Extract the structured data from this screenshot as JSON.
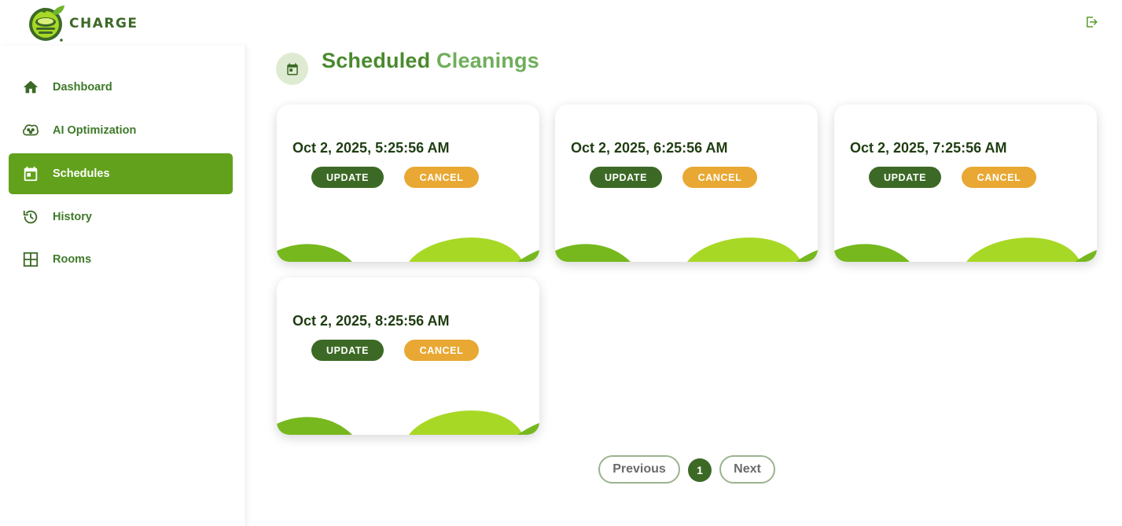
{
  "brand": {
    "name": "CHARGE"
  },
  "colors": {
    "primary_dark": "#3c6a26",
    "active_nav": "#61a11b",
    "cancel": "#e8a833",
    "wave_light": "#a8d826",
    "wave_dark": "#76b81e"
  },
  "sidebar": {
    "items": [
      {
        "label": "Dashboard",
        "icon": "home-icon",
        "active": false
      },
      {
        "label": "AI Optimization",
        "icon": "brain-icon",
        "active": false
      },
      {
        "label": "Schedules",
        "icon": "calendar-icon",
        "active": true
      },
      {
        "label": "History",
        "icon": "history-icon",
        "active": false
      },
      {
        "label": "Rooms",
        "icon": "grid-icon",
        "active": false
      }
    ]
  },
  "page": {
    "title_part1": "Scheduled",
    "title_part2": "Cleanings",
    "title_icon": "calendar-icon"
  },
  "cards": [
    {
      "date": "Oct 2, 2025, 5:25:56 AM",
      "update_label": "UPDATE",
      "cancel_label": "CANCEL"
    },
    {
      "date": "Oct 2, 2025, 6:25:56 AM",
      "update_label": "UPDATE",
      "cancel_label": "CANCEL"
    },
    {
      "date": "Oct 2, 2025, 7:25:56 AM",
      "update_label": "UPDATE",
      "cancel_label": "CANCEL"
    },
    {
      "date": "Oct 2, 2025, 8:25:56 AM",
      "update_label": "UPDATE",
      "cancel_label": "CANCEL"
    }
  ],
  "pagination": {
    "previous_label": "Previous",
    "current_page": "1",
    "next_label": "Next"
  },
  "header": {
    "logout_icon": "logout-icon"
  }
}
